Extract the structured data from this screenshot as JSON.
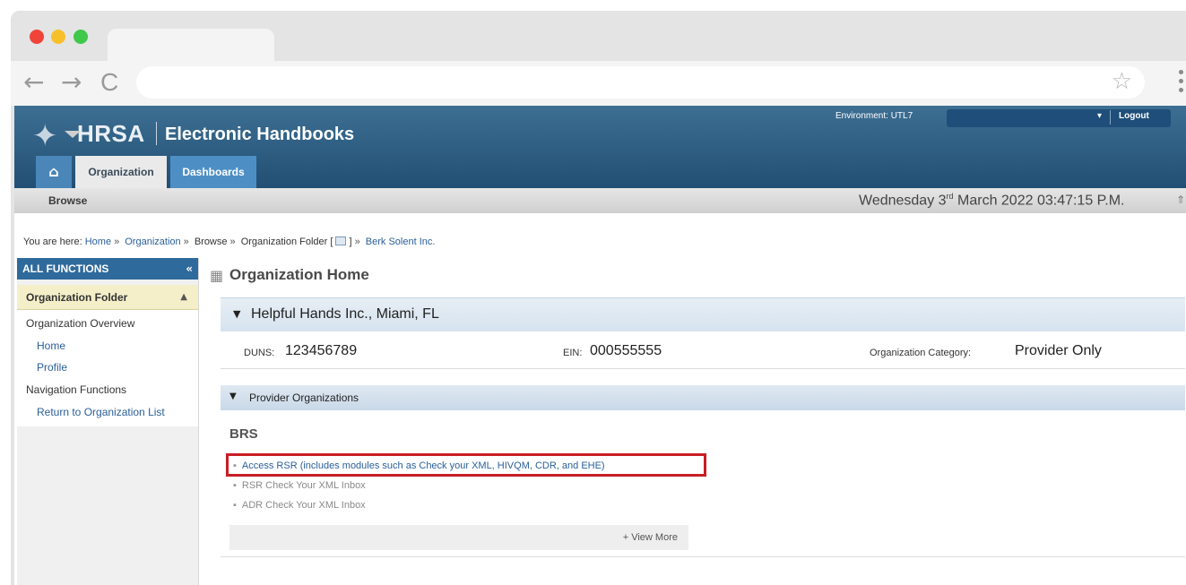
{
  "browser": {
    "nav": {
      "back": "←",
      "forward": "→",
      "reload": "C"
    },
    "star": "☆"
  },
  "header": {
    "logo": "HRSA",
    "app_title": "Electronic Handbooks",
    "environment": "Environment: UTL7",
    "logout": "Logout",
    "tabs": {
      "home_icon": "home-icon",
      "organization": "Organization",
      "dashboards": "Dashboards"
    }
  },
  "subnav": {
    "browse": "Browse",
    "datetime": {
      "day": "Wednesday 3",
      "suffix": "rd",
      "rest": " March 2022  03:47:15 P.M."
    }
  },
  "breadcrumb": {
    "prefix": "You are here:",
    "home": "Home",
    "organization": "Organization",
    "browse": "Browse",
    "folder_text": "Organization Folder [",
    "folder_close": "]",
    "org": "Berk Solent Inc."
  },
  "sidebar": {
    "header": "ALL FUNCTIONS",
    "collapse": "«",
    "folder": "Organization Folder",
    "sections": [
      {
        "title": "Organization Overview",
        "links": [
          "Home",
          "Profile"
        ]
      },
      {
        "title": "Navigation Functions",
        "links": [
          "Return to Organization List"
        ]
      }
    ]
  },
  "main": {
    "title": "Organization Home",
    "org": {
      "name": "Helpful Hands Inc., Miami, FL",
      "duns_label": "DUNS:",
      "duns": "123456789",
      "ein_label": "EIN:",
      "ein": "000555555",
      "category_label": "Organization Category:",
      "category": "Provider Only"
    },
    "provider": {
      "title": "Provider Organizations",
      "group": "BRS",
      "links": [
        "Access RSR (includes modules such as Check your XML, HIVQM, CDR, and EHE)",
        "RSR Check Your XML Inbox",
        "ADR Check Your XML Inbox"
      ],
      "view_more": "+ View More"
    }
  },
  "colors": {
    "header": "#2a5b80",
    "highlight": "#c81e25",
    "link": "#2a5f9a"
  }
}
